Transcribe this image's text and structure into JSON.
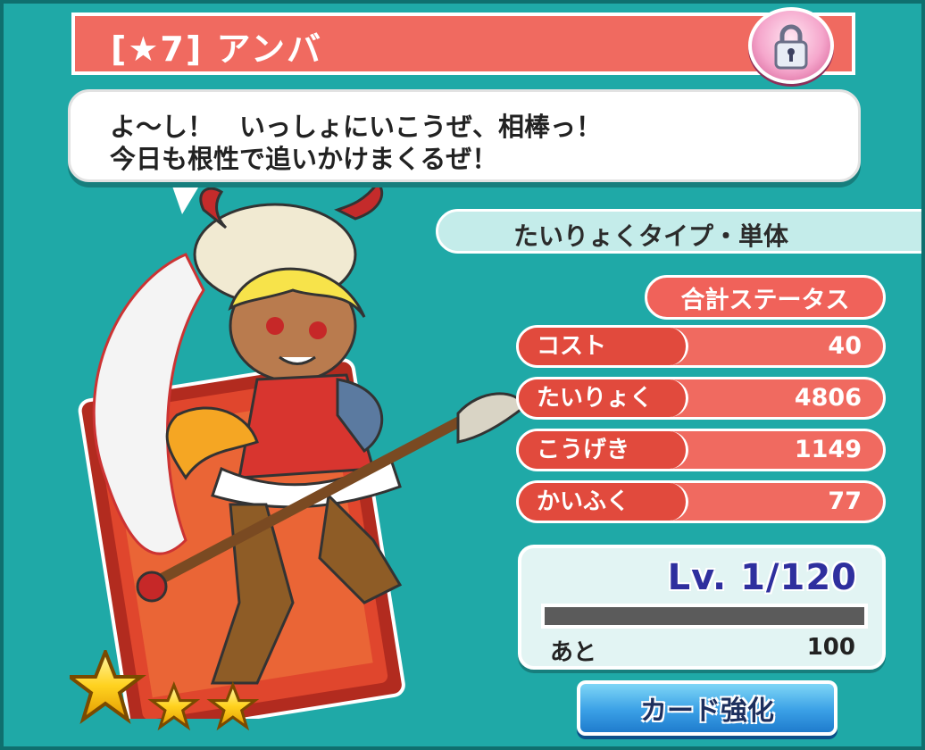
{
  "card": {
    "title": "[★7] アンバ",
    "rarity_stars": 3,
    "type": "たいりょくタイプ・単体"
  },
  "speech": {
    "line1": "よ～し！　いっしょにいこうぜ、相棒っ！",
    "line2": "今日も根性で追いかけまくるぜ！"
  },
  "status": {
    "section_label": "合計ステータス",
    "rows": [
      {
        "label": "コスト",
        "value": "40"
      },
      {
        "label": "たいりょく",
        "value": "4806"
      },
      {
        "label": "こうげき",
        "value": "1149"
      },
      {
        "label": "かいふく",
        "value": "77"
      }
    ]
  },
  "level": {
    "text": "Lv. 1/120",
    "exp_progress": 0,
    "remaining_label": "あと",
    "remaining_value": "100"
  },
  "buttons": {
    "enhance_label": "カード強化"
  },
  "icons": {
    "lock": "lock-icon",
    "star": "star-icon"
  },
  "colors": {
    "background": "#1fa9a7",
    "title_bar": "#f06a60",
    "stat_name": "#e14a3d",
    "level_text": "#2f2f9e",
    "button": "#3aa0e6"
  }
}
